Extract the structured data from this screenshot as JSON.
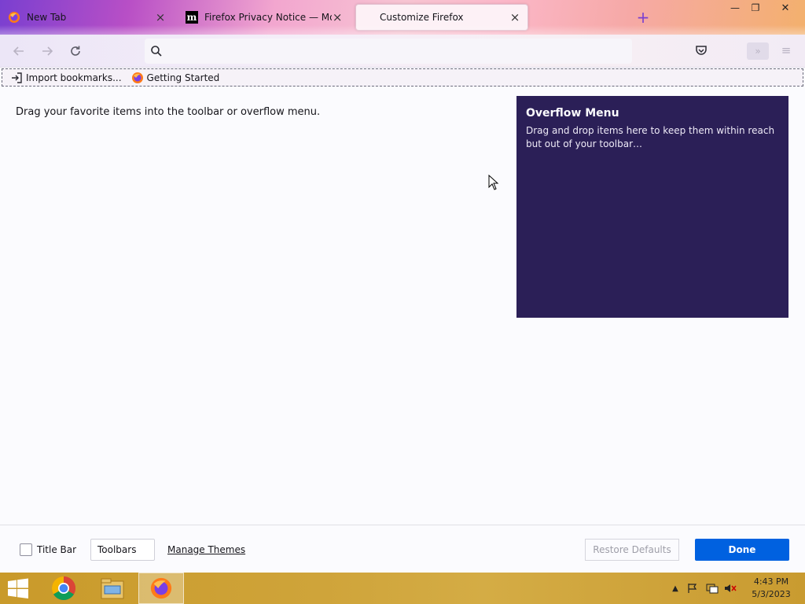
{
  "tabs": [
    {
      "title": "New Tab",
      "icon": "firefox-icon",
      "active": false
    },
    {
      "title": "Firefox Privacy Notice — Mozilla",
      "icon": "mozilla-m-icon",
      "active": false
    },
    {
      "title": "Customize Firefox",
      "icon": "none",
      "active": true
    }
  ],
  "window_controls": {
    "minimize": "—",
    "restore": "❐",
    "close": "✕"
  },
  "urlbar": {
    "value": "",
    "placeholder": ""
  },
  "bookmarks": [
    {
      "label": "Import bookmarks...",
      "icon": "import-icon"
    },
    {
      "label": "Getting Started",
      "icon": "firefox-icon"
    }
  ],
  "customize": {
    "palette_hint": "Drag your favorite items into the toolbar or overflow menu.",
    "overflow_title": "Overflow Menu",
    "overflow_desc": "Drag and drop items here to keep them within reach but out of your toolbar…",
    "overflow_bg": "#2b1f57"
  },
  "footer": {
    "title_bar_label": "Title Bar",
    "title_bar_checked": false,
    "toolbars_label": "Toolbars",
    "manage_themes_label": "Manage Themes",
    "restore_defaults_label": "Restore Defaults",
    "done_label": "Done",
    "done_color": "#0061e0"
  },
  "taskbar": {
    "apps": [
      "chrome-icon",
      "file-explorer-icon",
      "firefox-icon"
    ],
    "time": "4:43 PM",
    "date": "5/3/2023"
  }
}
